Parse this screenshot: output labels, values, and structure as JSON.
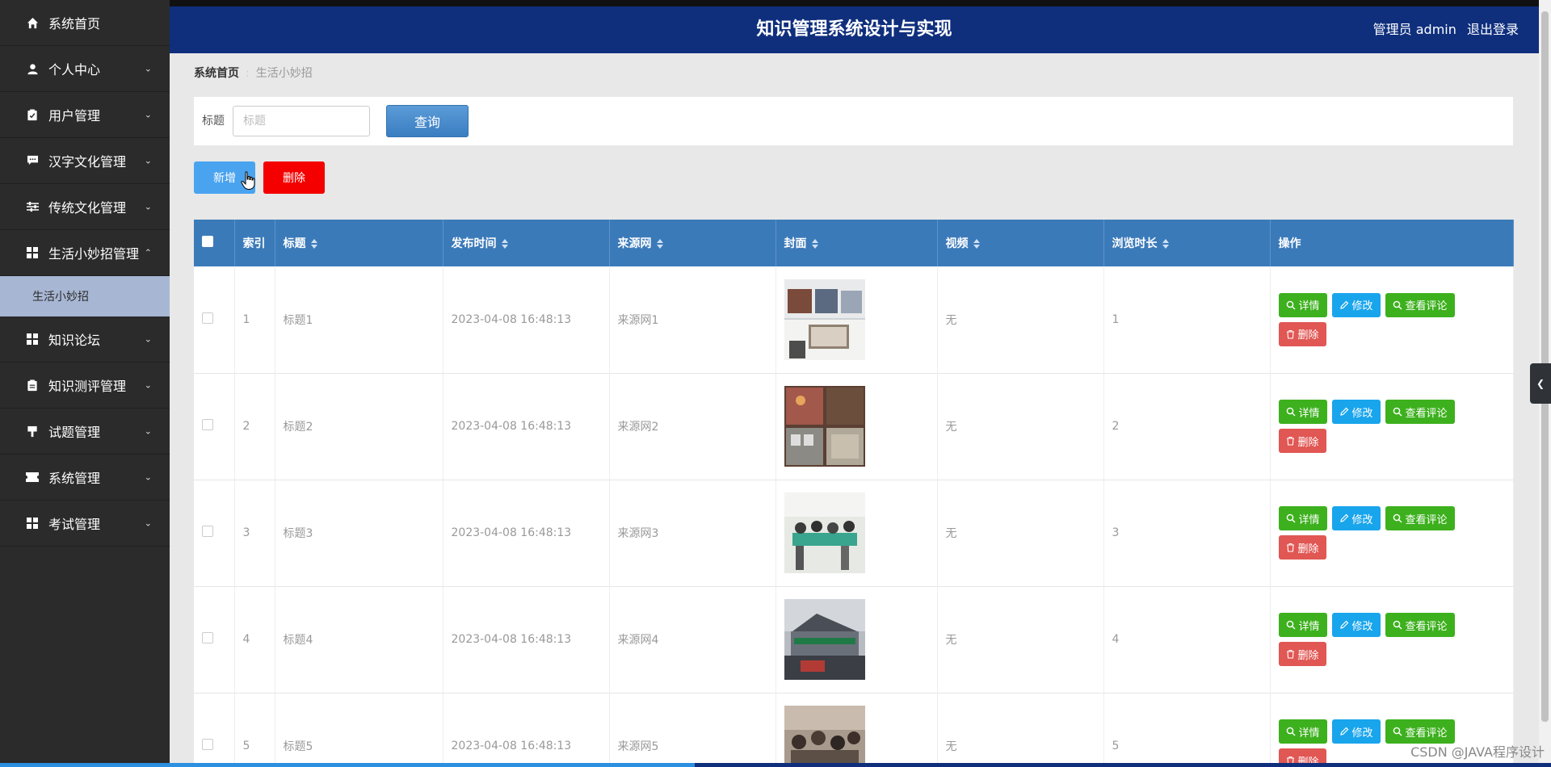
{
  "sidebar": {
    "items": [
      {
        "label": "系统首页",
        "icon": "home-icon"
      },
      {
        "label": "个人中心",
        "icon": "user-icon"
      },
      {
        "label": "用户管理",
        "icon": "clipboard-icon"
      },
      {
        "label": "汉字文化管理",
        "icon": "comment-icon"
      },
      {
        "label": "传统文化管理",
        "icon": "sliders-icon"
      },
      {
        "label": "生活小妙招管理",
        "icon": "grid-icon"
      },
      {
        "label": "知识论坛",
        "icon": "grid-icon"
      },
      {
        "label": "知识测评管理",
        "icon": "clipboard-icon"
      },
      {
        "label": "试题管理",
        "icon": "brush-icon"
      },
      {
        "label": "系统管理",
        "icon": "ticket-icon"
      },
      {
        "label": "考试管理",
        "icon": "grid-icon"
      }
    ],
    "active_sub": "生活小妙招"
  },
  "header": {
    "title": "知识管理系统设计与实现",
    "user": "管理员 admin",
    "logout": "退出登录"
  },
  "breadcrumb": {
    "home": "系统首页",
    "current": "生活小妙招"
  },
  "search": {
    "label": "标题",
    "placeholder": "标题",
    "button": "查询"
  },
  "actions": {
    "add": "新增",
    "delete": "删除"
  },
  "table": {
    "headers": [
      "索引",
      "标题",
      "发布时间",
      "来源网",
      "封面",
      "视频",
      "浏览时长",
      "操作"
    ],
    "rows": [
      {
        "index": "1",
        "title": "标题1",
        "time": "2023-04-08 16:48:13",
        "source": "来源网1",
        "video": "无",
        "duration": "1"
      },
      {
        "index": "2",
        "title": "标题2",
        "time": "2023-04-08 16:48:13",
        "source": "来源网2",
        "video": "无",
        "duration": "2"
      },
      {
        "index": "3",
        "title": "标题3",
        "time": "2023-04-08 16:48:13",
        "source": "来源网3",
        "video": "无",
        "duration": "3"
      },
      {
        "index": "4",
        "title": "标题4",
        "time": "2023-04-08 16:48:13",
        "source": "来源网4",
        "video": "无",
        "duration": "4"
      },
      {
        "index": "5",
        "title": "标题5",
        "time": "2023-04-08 16:48:13",
        "source": "来源网5",
        "video": "无",
        "duration": "5"
      }
    ],
    "op_labels": {
      "detail": "详情",
      "edit": "修改",
      "comment": "查看评论",
      "delete": "删除"
    }
  },
  "watermark": "CSDN @JAVA程序设计",
  "colors": {
    "header": "#0f2f7d",
    "sidebar": "#2b2b2b",
    "table_head": "#3b7ab9",
    "add": "#4aa3ef",
    "danger": "#f40000"
  }
}
